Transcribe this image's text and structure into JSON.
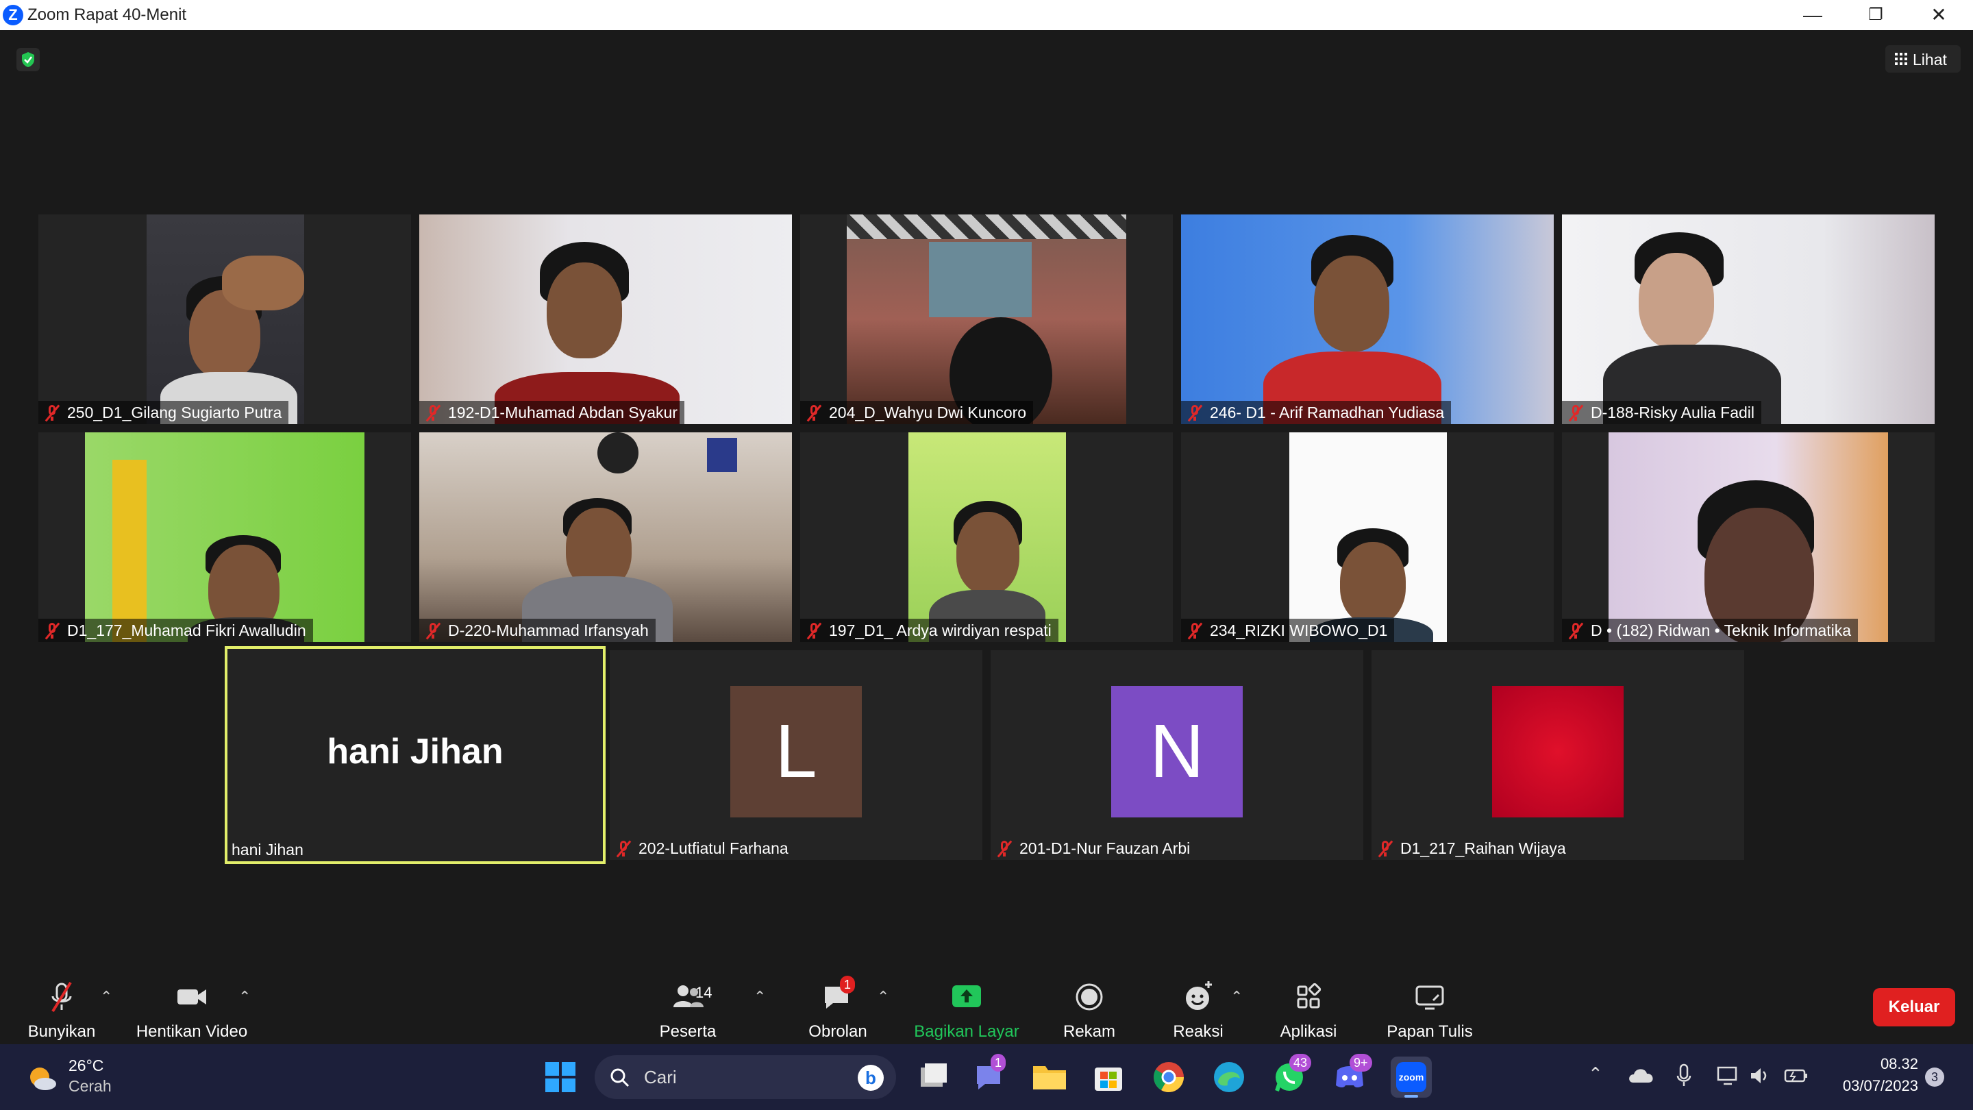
{
  "window": {
    "title": "Zoom Rapat 40-Menit",
    "minimize": "—",
    "restore": "❐",
    "close": "✕"
  },
  "topbar": {
    "view_label": "Lihat"
  },
  "participants_grid": [
    {
      "name": "250_D1_Gilang Sugiarto Putra",
      "muted": true
    },
    {
      "name": "192-D1-Muhamad Abdan Syakur",
      "muted": true
    },
    {
      "name": "204_D_Wahyu Dwi Kuncoro",
      "muted": true
    },
    {
      "name": "246- D1 - Arif Ramadhan Yudiasa",
      "muted": true
    },
    {
      "name": "D-188-Risky Aulia Fadil",
      "muted": true
    },
    {
      "name": "D1_177_Muhamad Fikri Awalludin",
      "muted": true
    },
    {
      "name": "D-220-Muhammad Irfansyah",
      "muted": true
    },
    {
      "name": "197_D1_ Ardya wirdiyan respati",
      "muted": true
    },
    {
      "name": "234_RIZKI WIBOWO_D1",
      "muted": true
    },
    {
      "name": "D • (182) Ridwan • Teknik Informatika",
      "muted": true
    }
  ],
  "bottom_row": {
    "active_speaker": {
      "display_name": "hani Jihan",
      "label": "hani Jihan"
    },
    "tiles": [
      {
        "name": "202-Lutfiatul Farhana",
        "initial": "L",
        "color": "#5e4034"
      },
      {
        "name": "201-D1-Nur Fauzan Arbi",
        "initial": "N",
        "color": "#7c4cc4"
      },
      {
        "name": "D1_217_Raihan Wijaya",
        "initial": "",
        "color": "#c8102e"
      }
    ]
  },
  "toolbar": {
    "unmute": "Bunyikan",
    "stop_video": "Hentikan Video",
    "participants": "Peserta",
    "participants_count": "14",
    "chat": "Obrolan",
    "chat_badge": "1",
    "share": "Bagikan Layar",
    "record": "Rekam",
    "reactions": "Reaksi",
    "apps": "Aplikasi",
    "whiteboard": "Papan Tulis",
    "leave": "Keluar",
    "accent_green": "#21c65a",
    "leave_color": "#e02020"
  },
  "taskbar": {
    "weather_temp": "26°C",
    "weather_desc": "Cerah",
    "search_placeholder": "Cari",
    "teams_badge": "1",
    "whatsapp_badge": "43",
    "discord_badge": "9+",
    "zoom_label": "zoom",
    "time": "08.32",
    "date": "03/07/2023",
    "notification_count": "3"
  }
}
